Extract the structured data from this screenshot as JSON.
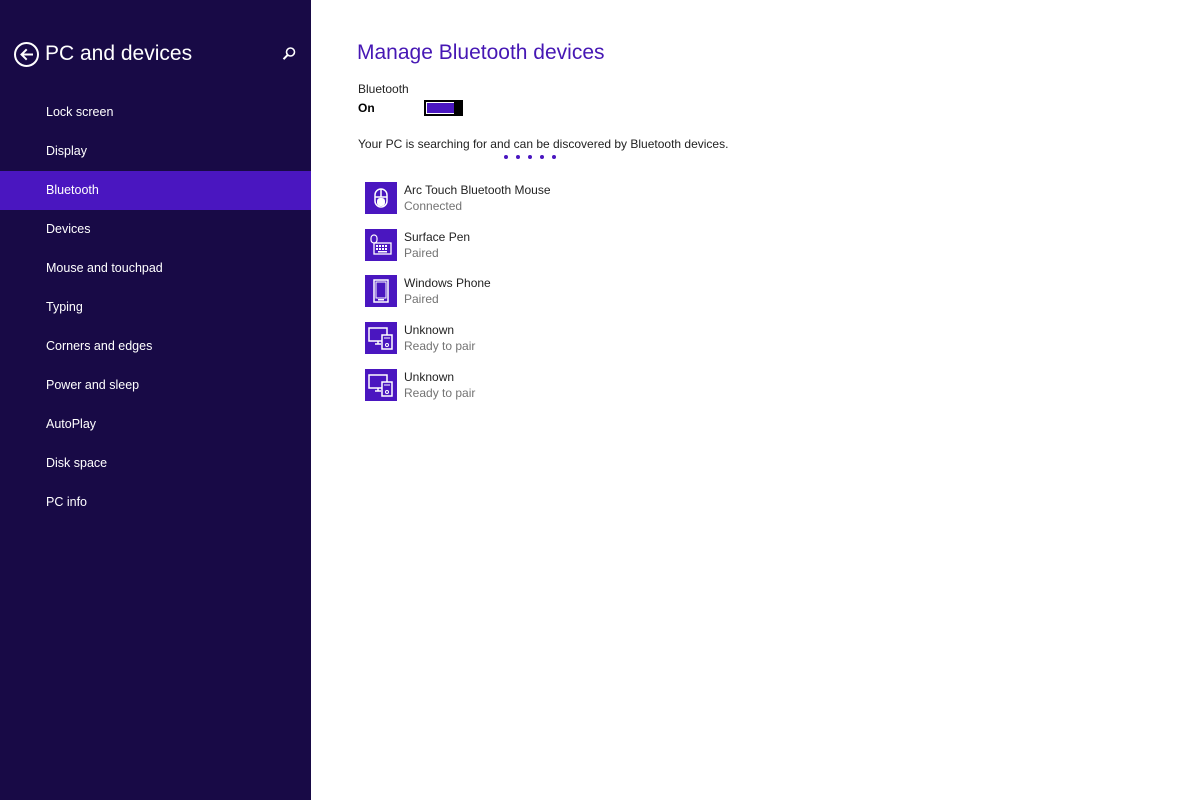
{
  "sidebar": {
    "title": "PC and devices",
    "back_icon": "back-arrow-icon",
    "search_icon": "search-icon",
    "background_color": "#180a46",
    "selected_color": "#4a16c0",
    "items": [
      {
        "label": "Lock screen",
        "selected": false
      },
      {
        "label": "Display",
        "selected": false
      },
      {
        "label": "Bluetooth",
        "selected": true
      },
      {
        "label": "Devices",
        "selected": false
      },
      {
        "label": "Mouse and touchpad",
        "selected": false
      },
      {
        "label": "Typing",
        "selected": false
      },
      {
        "label": "Corners and edges",
        "selected": false
      },
      {
        "label": "Power and sleep",
        "selected": false
      },
      {
        "label": "AutoPlay",
        "selected": false
      },
      {
        "label": "Disk space",
        "selected": false
      },
      {
        "label": "PC info",
        "selected": false
      }
    ]
  },
  "main": {
    "title": "Manage Bluetooth devices",
    "accent_color": "#4617b4",
    "bluetooth": {
      "label": "Bluetooth",
      "state": "On",
      "enabled": true
    },
    "status_text": "Your PC is searching for and can be discovered by Bluetooth devices.",
    "devices": [
      {
        "name": "Arc Touch Bluetooth Mouse",
        "status": "Connected",
        "icon": "mouse-icon"
      },
      {
        "name": "Surface Pen",
        "status": "Paired",
        "icon": "keyboard-mouse-icon"
      },
      {
        "name": "Windows Phone",
        "status": "Paired",
        "icon": "phone-icon"
      },
      {
        "name": "Unknown",
        "status": "Ready to pair",
        "icon": "devices-icon"
      },
      {
        "name": "Unknown",
        "status": "Ready to pair",
        "icon": "devices-icon"
      }
    ]
  }
}
